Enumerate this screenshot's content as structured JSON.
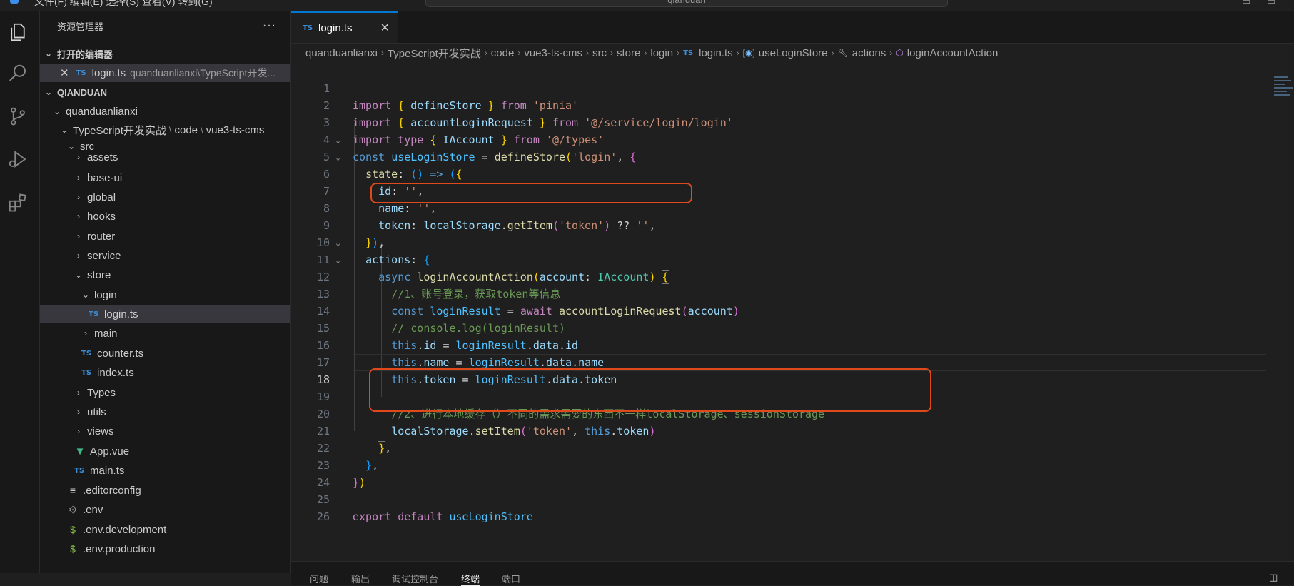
{
  "titlebar": {
    "menu": "文件(F)   编辑(E)   选择(S)   查看(V)   转到(G)",
    "command_center": "qianduan"
  },
  "sidebar": {
    "title": "资源管理器",
    "more": "···",
    "open_editors_title": "打开的编辑器",
    "open_editor": {
      "type": "TS",
      "name": "login.ts",
      "path": "quanduanlianxi\\TypeScript开发..."
    },
    "root_title": "QIANDUAN",
    "tree": {
      "quanduanlianxi": "quanduanlianxi",
      "path_a": "TypeScript开发实战",
      "path_b": "code",
      "path_c": "vue3-ts-cms",
      "src": "src",
      "assets": "assets",
      "base_ui": "base-ui",
      "global": "global",
      "hooks": "hooks",
      "router": "router",
      "service": "service",
      "store": "store",
      "login": "login",
      "login_ts": "login.ts",
      "main": "main",
      "counter_ts": "counter.ts",
      "index_ts": "index.ts",
      "types": "Types",
      "utils": "utils",
      "views": "views",
      "app_vue": "App.vue",
      "main_ts": "main.ts",
      "editorconfig": ".editorconfig",
      "env": ".env",
      "env_development": ".env.development",
      "env_production": ".env.production"
    },
    "ts_badge": "TS"
  },
  "editor": {
    "tab": {
      "type": "TS",
      "name": "login.ts",
      "close": "✕"
    },
    "breadcrumb": [
      "quanduanlianxi",
      "TypeScript开发实战",
      "code",
      "vue3-ts-cms",
      "src",
      "store",
      "login",
      "login.ts",
      "useLoginStore",
      "actions",
      "loginAccountAction"
    ],
    "breadcrumb_ts": "TS",
    "current_line": 18
  },
  "code": {
    "l1": [
      "import",
      "{",
      "defineStore",
      "}",
      "from",
      "'pinia'"
    ],
    "l2": [
      "import",
      "{",
      "accountLoginRequest",
      "}",
      "from",
      "'@/service/login/login'"
    ],
    "l3": [
      "import",
      "type",
      "{",
      "IAccount",
      "}",
      "from",
      "'@/types'"
    ],
    "l4": [
      "const",
      "useLoginStore",
      "=",
      "defineStore",
      "(",
      "'login'",
      ",",
      "{"
    ],
    "l5": [
      "state",
      ":",
      "()",
      "=>",
      "(",
      "{"
    ],
    "l6": [
      "id",
      ":",
      "''",
      ","
    ],
    "l7": [
      "name",
      ":",
      "''",
      ","
    ],
    "l8": [
      "token",
      ":",
      "localStorage",
      ".",
      "getItem",
      "(",
      "'token'",
      ")",
      "??",
      "''",
      ","
    ],
    "l9": [
      "}",
      ")",
      ","
    ],
    "l10": [
      "actions",
      ":",
      "{"
    ],
    "l11": [
      "async",
      "loginAccountAction",
      "(",
      "account",
      ":",
      "IAccount",
      ")",
      "{"
    ],
    "l12": "//1、账号登录，获取token等信息",
    "l13": [
      "const",
      "loginResult",
      "=",
      "await",
      "accountLoginRequest",
      "(",
      "account",
      ")"
    ],
    "l14": "// console.log(loginResult)",
    "l15": [
      "this",
      ".",
      "id",
      "=",
      "loginResult",
      ".",
      "data",
      ".",
      "id"
    ],
    "l16": [
      "this",
      ".",
      "name",
      "=",
      "loginResult",
      ".",
      "data",
      ".",
      "name"
    ],
    "l17": [
      "this",
      ".",
      "token",
      "=",
      "loginResult",
      ".",
      "data",
      ".",
      "token"
    ],
    "l19": "//2、进行本地缓存（）不同的需求需要的东西不一样localStorage、sessionStorage",
    "l20": [
      "localStorage",
      ".",
      "setItem",
      "(",
      "'token'",
      ",",
      "this",
      ".",
      "token",
      ")"
    ],
    "l21": [
      "}",
      ","
    ],
    "l22": [
      "}",
      ","
    ],
    "l23": [
      "}",
      ")"
    ],
    "l25": [
      "export",
      "default",
      "useLoginStore"
    ]
  },
  "panel_tabs": [
    "问题",
    "输出",
    "调试控制台",
    "终端",
    "端口"
  ],
  "colors": {
    "accent": "#0078d4",
    "highlight_box": "#e0491b",
    "ts_icon": "#3b8fd9",
    "vue_icon": "#41b883"
  }
}
